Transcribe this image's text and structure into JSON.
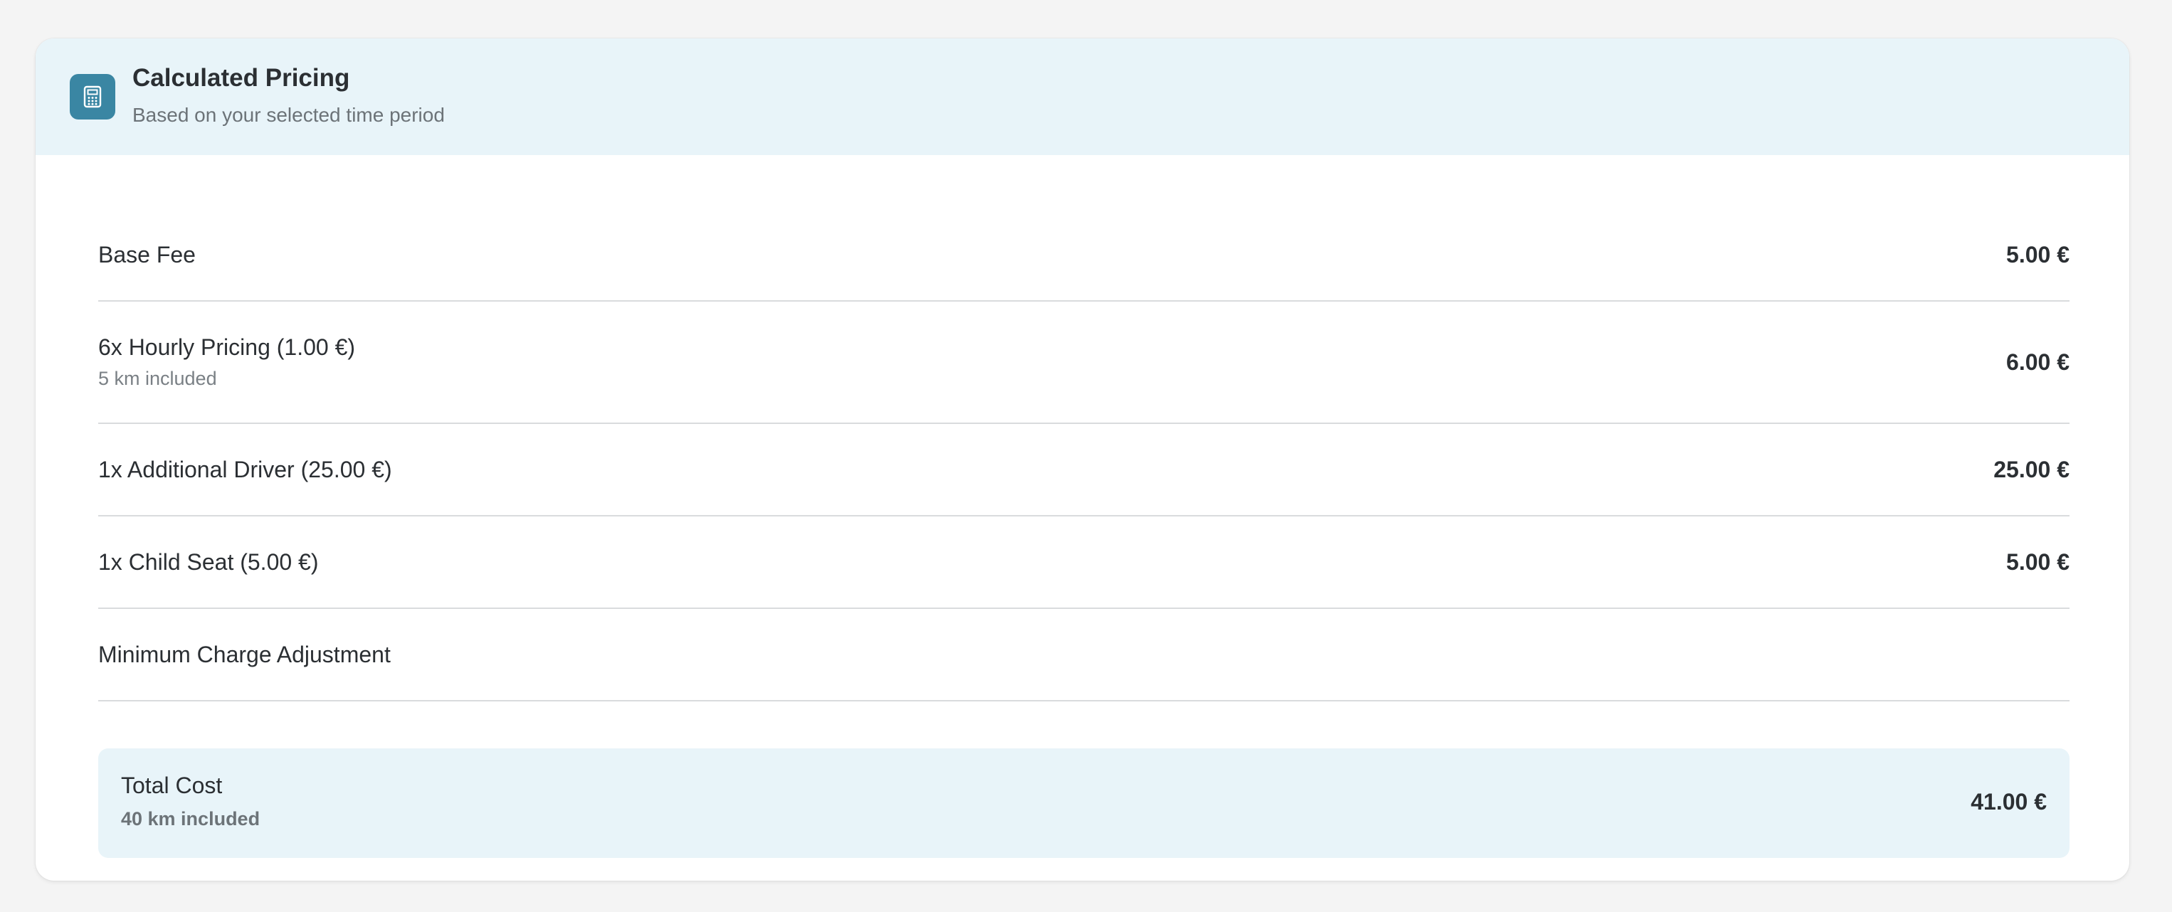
{
  "header": {
    "icon": "calculator-icon",
    "title": "Calculated Pricing",
    "subtitle": "Based on your selected time period"
  },
  "items": [
    {
      "label": "Base Fee",
      "sublabel": "",
      "amount": "5.00 €"
    },
    {
      "label": "6x Hourly Pricing (1.00 €)",
      "sublabel": "5 km included",
      "amount": "6.00 €"
    },
    {
      "label": "1x Additional Driver (25.00 €)",
      "sublabel": "",
      "amount": "25.00 €"
    },
    {
      "label": "1x Child Seat (5.00 €)",
      "sublabel": "",
      "amount": "5.00 €"
    },
    {
      "label": "Minimum Charge Adjustment",
      "sublabel": "",
      "amount": ""
    }
  ],
  "total": {
    "label": "Total Cost",
    "sublabel": "40 km included",
    "amount": "41.00 €"
  },
  "colors": {
    "accent": "#3a86a3",
    "header_bg": "#e8f4f9",
    "page_bg": "#f4f4f4"
  }
}
